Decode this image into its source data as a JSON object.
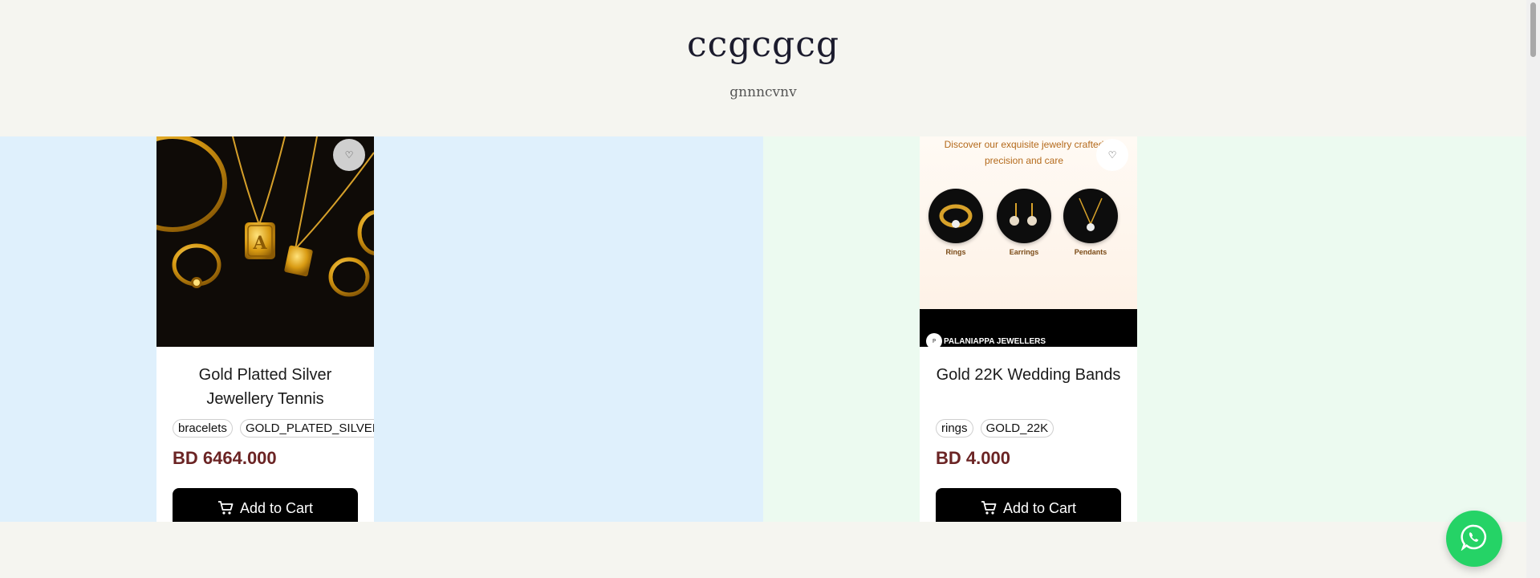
{
  "header": {
    "title": "ccgcgcg",
    "subtitle": "gnnncvnv"
  },
  "products": [
    {
      "name": "Gold Platted Silver Jewellery Tennis",
      "tags": [
        "bracelets",
        "GOLD_PLATED_SILVER"
      ],
      "price": "BD 6464.000",
      "add_to_cart_label": "Add to Cart",
      "favorite_icon": "heart-icon"
    },
    {
      "name": "Gold 22K Wedding Bands",
      "tags": [
        "rings",
        "GOLD_22K"
      ],
      "price": "BD 4.000",
      "add_to_cart_label": "Add to Cart",
      "favorite_icon": "heart-icon",
      "image": {
        "headline": "Discover our exquisite jewelry crafted precision and care",
        "categories": [
          "Rings",
          "Earrings",
          "Pendants"
        ],
        "brand": "PALANIAPPA JEWELLERS"
      }
    }
  ],
  "colors": {
    "price": "#6b2424",
    "whatsapp": "#25d366",
    "left_band": "#dff0fc",
    "right_band": "#ecfaf0"
  },
  "whatsapp_icon": "whatsapp-icon"
}
